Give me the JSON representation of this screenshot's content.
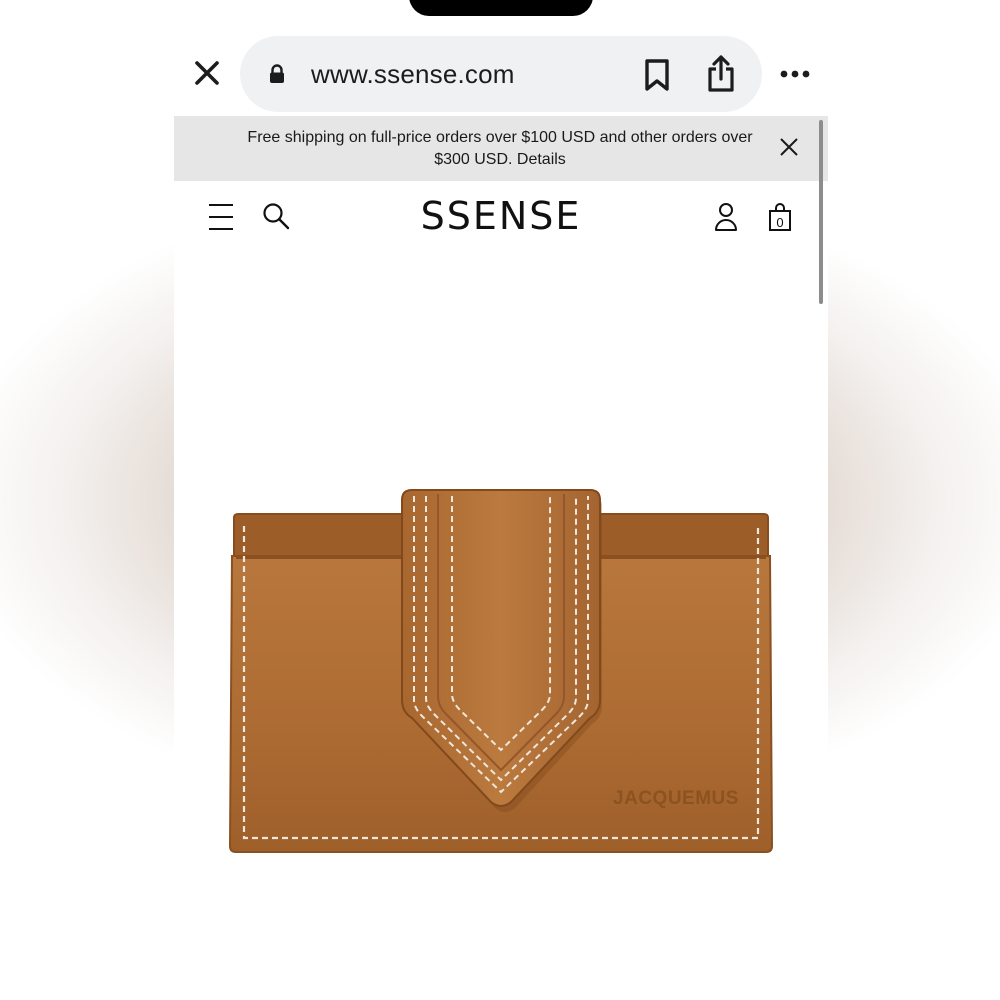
{
  "browser": {
    "url": "www.ssense.com",
    "close_icon": "close-icon",
    "lock_icon": "lock-icon",
    "bookmark_icon": "bookmark-icon",
    "share_icon": "share-icon",
    "more_icon": "more-icon"
  },
  "banner": {
    "text": "Free shipping on full-price orders over $100 USD and other orders over $300 USD. Details",
    "close_icon": "close-icon"
  },
  "header": {
    "logo": "SSENSE",
    "menu_icon": "hamburger-icon",
    "search_icon": "search-icon",
    "account_icon": "account-icon",
    "bag_icon": "shopping-bag-icon",
    "bag_count": "0"
  },
  "product": {
    "brand_emboss": "JACQUEMUS",
    "leather_color": "#b06f36",
    "stitch_color": "#efe6dc"
  }
}
